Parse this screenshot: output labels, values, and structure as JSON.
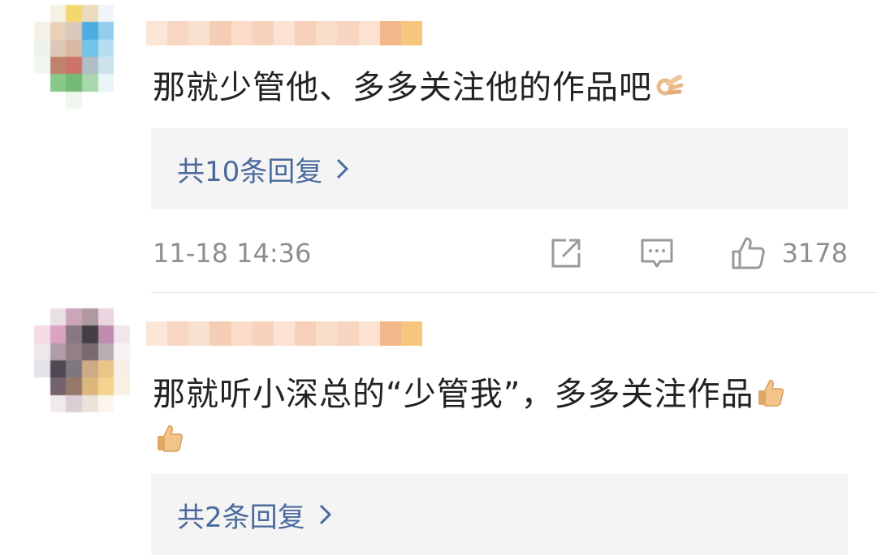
{
  "comments": [
    {
      "text": "那就少管他、多多关注他的作品吧",
      "emoji": "ok-hand-emoji",
      "replies_label": "共10条回复",
      "timestamp": "11-18 14:36",
      "like_count": "3178"
    },
    {
      "text": "那就听小深总的“少管我”，多多关注作品",
      "emoji": "thumbs-up-emoji",
      "replies_label": "共2条回复"
    }
  ],
  "icons": {
    "share": "share-icon",
    "comment": "comment-icon",
    "like": "thumbs-up-icon",
    "chevron": "chevron-right-icon"
  },
  "colors": {
    "reply_link": "#4a6a9c",
    "meta_text": "#8e8e8e",
    "reply_box_bg": "#f4f4f4",
    "comment_text": "#222222"
  }
}
